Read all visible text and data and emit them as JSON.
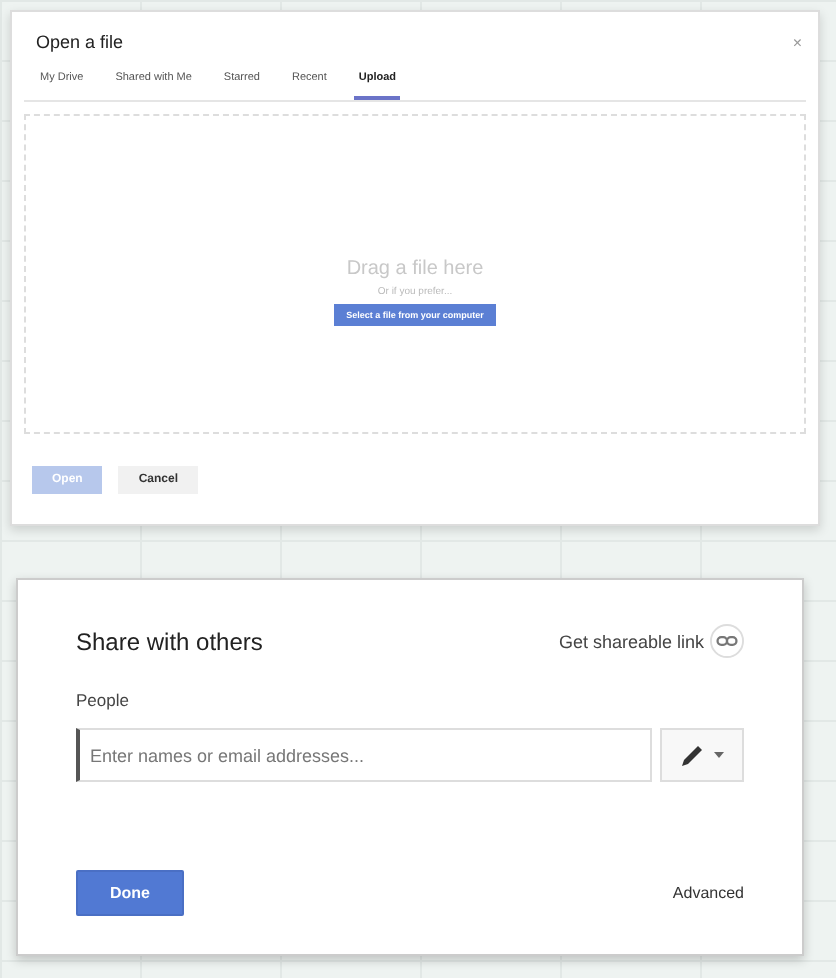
{
  "open_dialog": {
    "title": "Open a file",
    "close": "×",
    "tabs": [
      {
        "label": "My Drive",
        "selected": false
      },
      {
        "label": "Shared with Me",
        "selected": false
      },
      {
        "label": "Starred",
        "selected": false
      },
      {
        "label": "Recent",
        "selected": false
      },
      {
        "label": "Upload",
        "selected": true
      }
    ],
    "drop_zone": {
      "heading": "Drag a file here",
      "hint": "Or if you prefer...",
      "button": "Select a file from your computer"
    },
    "buttons": [
      {
        "label": "Open",
        "kind": "primary",
        "disabled": true
      },
      {
        "label": "Cancel",
        "kind": "secondary",
        "disabled": false
      }
    ]
  },
  "share_dialog": {
    "title": "Share with others",
    "link": "Get shareable link",
    "people_label": "People",
    "people_field": {
      "placeholder": "Enter names or email addresses..."
    },
    "done": "Done",
    "advanced": "Advanced"
  }
}
